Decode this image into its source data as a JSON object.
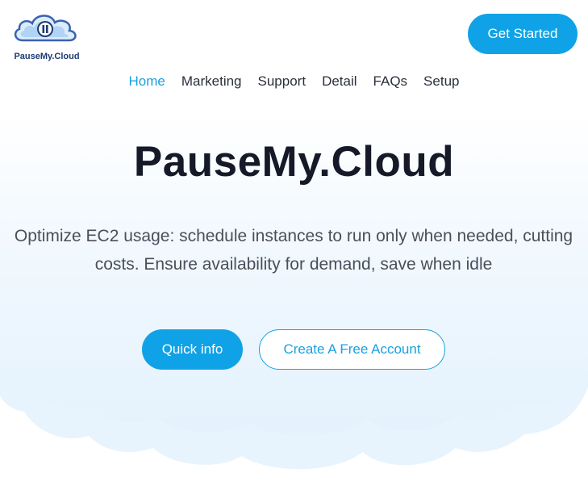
{
  "brand": {
    "name": "PauseMy.Cloud",
    "logo_icon": "cloud-pause-icon"
  },
  "header": {
    "cta_label": "Get Started"
  },
  "nav": {
    "items": [
      {
        "label": "Home",
        "active": true
      },
      {
        "label": "Marketing",
        "active": false
      },
      {
        "label": "Support",
        "active": false
      },
      {
        "label": "Detail",
        "active": false
      },
      {
        "label": "FAQs",
        "active": false
      },
      {
        "label": "Setup",
        "active": false
      }
    ]
  },
  "hero": {
    "title": "PauseMy.Cloud",
    "description": "Optimize EC2 usage: schedule instances to run only when needed, cutting costs. Ensure availability for demand, save when idle",
    "primary_button": "Quick info",
    "secondary_button": "Create A Free Account"
  },
  "colors": {
    "accent": "#10a2e6",
    "title": "#161a28",
    "text": "#4a4f5b",
    "hero_background": "#eaf6fe"
  }
}
